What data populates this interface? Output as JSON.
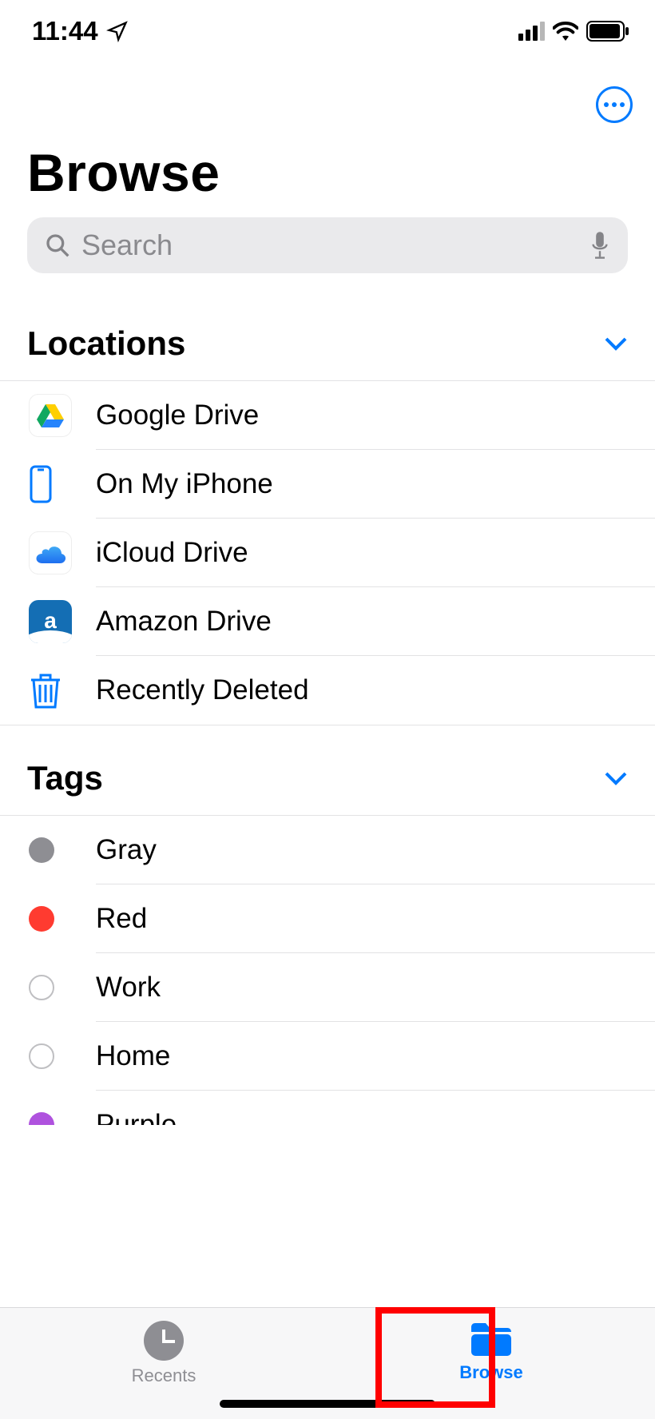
{
  "status": {
    "time": "11:44"
  },
  "page": {
    "title": "Browse"
  },
  "search": {
    "placeholder": "Search"
  },
  "sections": {
    "locations": {
      "header": "Locations",
      "items": [
        {
          "label": "Google Drive",
          "icon": "google-drive"
        },
        {
          "label": "On My iPhone",
          "icon": "iphone"
        },
        {
          "label": "iCloud Drive",
          "icon": "icloud"
        },
        {
          "label": "Amazon Drive",
          "icon": "amazon"
        },
        {
          "label": "Recently Deleted",
          "icon": "trash"
        }
      ]
    },
    "tags": {
      "header": "Tags",
      "items": [
        {
          "label": "Gray",
          "color": "#8e8e93",
          "filled": true
        },
        {
          "label": "Red",
          "color": "#ff3b30",
          "filled": true
        },
        {
          "label": "Work",
          "color": "",
          "filled": false
        },
        {
          "label": "Home",
          "color": "",
          "filled": false
        },
        {
          "label": "Purple",
          "color": "#af52de",
          "filled": true
        }
      ]
    }
  },
  "tabbar": {
    "recents": "Recents",
    "browse": "Browse",
    "active": "browse"
  }
}
